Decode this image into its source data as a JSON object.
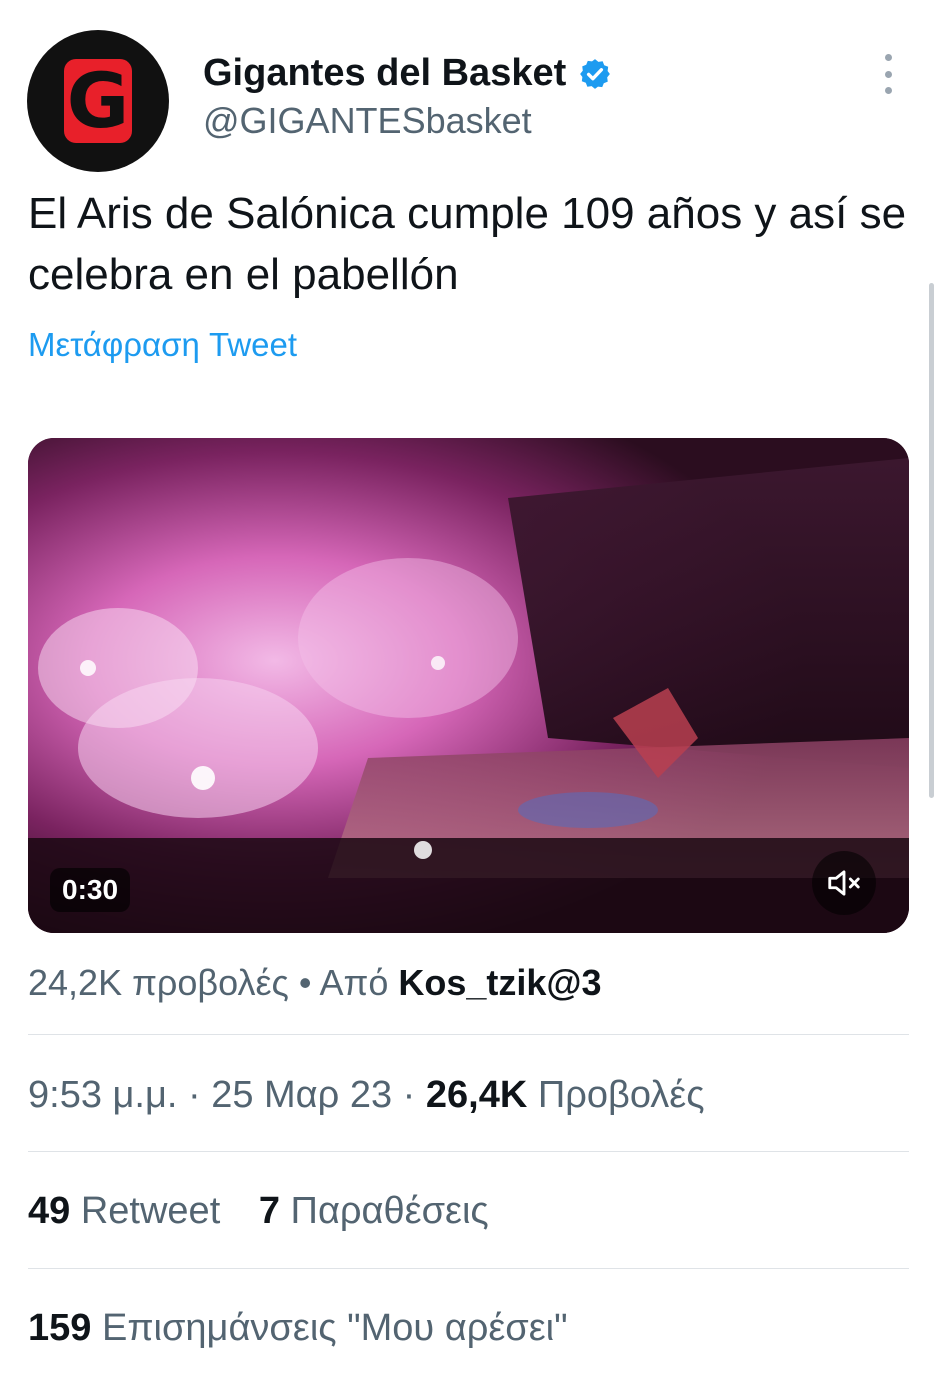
{
  "author": {
    "display_name": "Gigantes del Basket",
    "handle": "@GIGANTESbasket",
    "avatar_letter": "G",
    "verified": true
  },
  "tweet": {
    "text": "El Aris de Salónica cumple 109 años y así se celebra en el pabellón",
    "translate_label": "Μετάφραση Tweet"
  },
  "media": {
    "type": "video",
    "duration": "0:30",
    "muted": true
  },
  "video_info": {
    "views": "24,2K προβολές",
    "separator": "•",
    "from_label": "Από",
    "from_user": "Kos_tzik@3"
  },
  "timestamp": {
    "time": "9:53 μ.μ.",
    "sep1": "·",
    "date": "25 Μαρ 23",
    "sep2": "·",
    "views_count": "26,4K",
    "views_label": "Προβολές"
  },
  "engagement": {
    "retweets_count": "49",
    "retweets_label": "Retweet",
    "quotes_count": "7",
    "quotes_label": "Παραθέσεις",
    "likes_count": "159",
    "likes_label": "Επισημάνσεις \"Μου αρέσει\""
  },
  "icons": {
    "verified": "verified-badge-icon",
    "more": "more-options-icon",
    "mute": "speaker-muted-icon"
  },
  "colors": {
    "link": "#1d9bf0",
    "secondary_text": "#536471",
    "primary_text": "#0f1419",
    "avatar_red": "#e8202a"
  }
}
